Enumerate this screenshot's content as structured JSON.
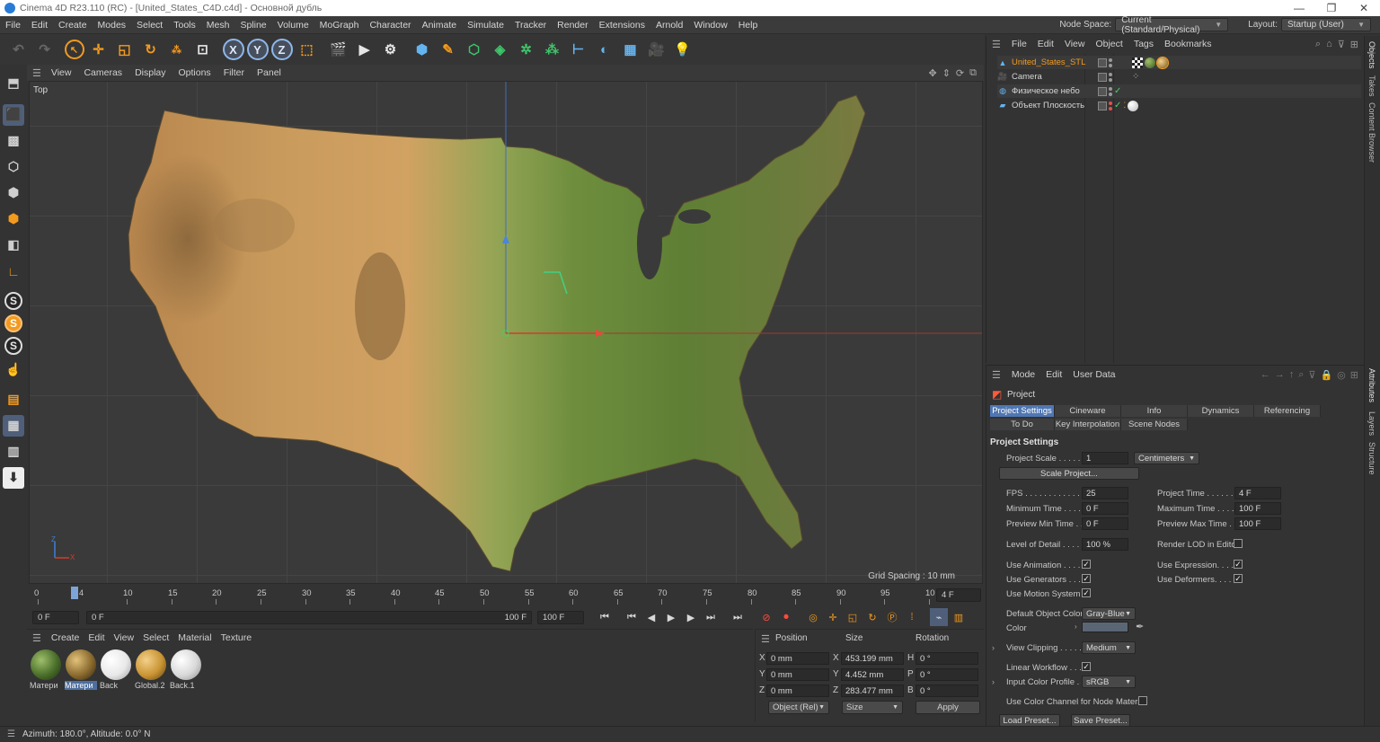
{
  "window": {
    "title": "Cinema 4D R23.110 (RC) - [United_States_C4D.c4d] - Основной дубль",
    "controls": [
      "—",
      "❐",
      "✕"
    ]
  },
  "menubar": {
    "items": [
      "File",
      "Edit",
      "Create",
      "Modes",
      "Select",
      "Tools",
      "Mesh",
      "Spline",
      "Volume",
      "MoGraph",
      "Character",
      "Animate",
      "Simulate",
      "Tracker",
      "Render",
      "Extensions",
      "Arnold",
      "Window",
      "Help"
    ],
    "node_space_label": "Node Space:",
    "node_space_value": "Current (Standard/Physical)",
    "layout_label": "Layout:",
    "layout_value": "Startup (User)"
  },
  "toolbar": {
    "axis_x": "X",
    "axis_y": "Y",
    "axis_z": "Z"
  },
  "viewport": {
    "menu": [
      "View",
      "Cameras",
      "Display",
      "Options",
      "Filter",
      "Panel"
    ],
    "view_name": "Top",
    "grid_spacing": "Grid Spacing : 10 mm",
    "axis_z": "Z",
    "axis_x": "X"
  },
  "timeline": {
    "ticks": [
      "0",
      "10",
      "15",
      "20",
      "25",
      "30",
      "35",
      "40",
      "45",
      "50",
      "55",
      "60",
      "65",
      "70",
      "75",
      "80",
      "85",
      "90",
      "95",
      "10"
    ],
    "current_frame_marker": "4",
    "end_field": "4 F",
    "start_field": "0 F",
    "range_start": "0 F",
    "range_end": "100 F",
    "max_field": "100 F"
  },
  "material_manager": {
    "menu": [
      "Create",
      "Edit",
      "View",
      "Select",
      "Material",
      "Texture"
    ],
    "materials": [
      {
        "name": "Матери",
        "color": "#4a6e2a"
      },
      {
        "name": "Матери",
        "color": "#8a6a2e"
      },
      {
        "name": "Back",
        "color": "#e8e8e8"
      },
      {
        "name": "Global.2",
        "color": "#c99433"
      },
      {
        "name": "Back.1",
        "color": "#d8d8d8"
      }
    ]
  },
  "coordinates": {
    "headers": [
      "Position",
      "Size",
      "Rotation"
    ],
    "rows": [
      {
        "axis": "X",
        "pos": "0 mm",
        "size_axis": "X",
        "size": "453.199 mm",
        "rot_axis": "H",
        "rot": "0 °"
      },
      {
        "axis": "Y",
        "pos": "0 mm",
        "size_axis": "Y",
        "size": "4.452 mm",
        "rot_axis": "P",
        "rot": "0 °"
      },
      {
        "axis": "Z",
        "pos": "0 mm",
        "size_axis": "Z",
        "size": "283.477 mm",
        "rot_axis": "B",
        "rot": "0 °"
      }
    ],
    "mode": "Object (Rel)",
    "size_mode": "Size",
    "apply": "Apply"
  },
  "status": {
    "text": "Azimuth: 180.0°, Altitude: 0.0°  N"
  },
  "object_manager": {
    "menu": [
      "File",
      "Edit",
      "View",
      "Object",
      "Tags",
      "Bookmarks"
    ],
    "objects": [
      {
        "name": "United_States_STL",
        "selected": true
      },
      {
        "name": "Camera",
        "selected": false
      },
      {
        "name": "Физическое небо",
        "selected": false
      },
      {
        "name": "Объект Плоскость",
        "selected": false
      }
    ]
  },
  "side_tabs": [
    "Objects",
    "Takes",
    "Content Browser",
    "Attributes",
    "Layers",
    "Structure"
  ],
  "attributes": {
    "menu": [
      "Mode",
      "Edit",
      "User Data"
    ],
    "object_title": "Project",
    "tabs_row1": [
      "Project Settings",
      "Cineware",
      "Info",
      "Dynamics",
      "Referencing"
    ],
    "tabs_row2": [
      "To Do",
      "Key Interpolation",
      "Scene Nodes"
    ],
    "section_title": "Project Settings",
    "project_scale_label": "Project Scale . . . . . .",
    "project_scale_value": "1",
    "project_scale_unit": "Centimeters",
    "scale_project_button": "Scale Project...",
    "fps_label": "FPS . . . . . . . . . . . . .",
    "fps_value": "25",
    "project_time_label": "Project Time . . . . . .",
    "project_time_value": "4 F",
    "min_time_label": "Minimum Time . . . .",
    "min_time_value": "0 F",
    "max_time_label": "Maximum Time . . . .",
    "max_time_value": "100 F",
    "preview_min_label": "Preview Min Time . .",
    "preview_min_value": "0 F",
    "preview_max_label": "Preview Max Time . .",
    "preview_max_value": "100 F",
    "lod_label": "Level of Detail . . . . .",
    "lod_value": "100 %",
    "render_lod_label": "Render LOD in Editor",
    "use_animation_label": "Use Animation . . . .",
    "use_expression_label": "Use Expression. . . .",
    "use_generators_label": "Use Generators . . .",
    "use_deformers_label": "Use Deformers. . . . .",
    "use_motion_label": "Use Motion System",
    "default_color_label": "Default Object Color",
    "default_color_value": "Gray-Blue",
    "color_label": "Color",
    "view_clipping_label": "View Clipping . . . . .",
    "view_clipping_value": "Medium",
    "linear_workflow_label": "Linear Workflow . . .",
    "input_profile_label": "Input Color Profile . .",
    "input_profile_value": "sRGB",
    "node_color_label": "Use Color Channel for Node Material",
    "load_preset": "Load Preset...",
    "save_preset": "Save Preset..."
  },
  "colors": {
    "accent": "#f39a1e",
    "selection": "#5077b3",
    "background": "#333333"
  }
}
